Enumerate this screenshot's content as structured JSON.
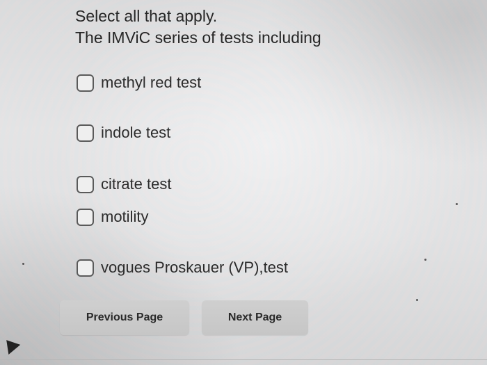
{
  "question": {
    "instruction": "Select all that apply.",
    "prompt": "The IMViC series of tests including"
  },
  "options": [
    {
      "label": "methyl red test",
      "checked": false
    },
    {
      "label": "indole test",
      "checked": false
    },
    {
      "label": "citrate test",
      "checked": false
    },
    {
      "label": "motility",
      "checked": false
    },
    {
      "label": "vogues Proskauer (VP),test",
      "checked": false
    }
  ],
  "navigation": {
    "previous_label": "Previous Page",
    "next_label": "Next Page"
  },
  "icons": {
    "pointer": "mouse-pointer-icon",
    "checkbox": "checkbox-icon"
  },
  "colors": {
    "button_bg": "#c9c9c9",
    "text": "#2b2b2b",
    "checkbox_border": "#5a5a5a"
  }
}
